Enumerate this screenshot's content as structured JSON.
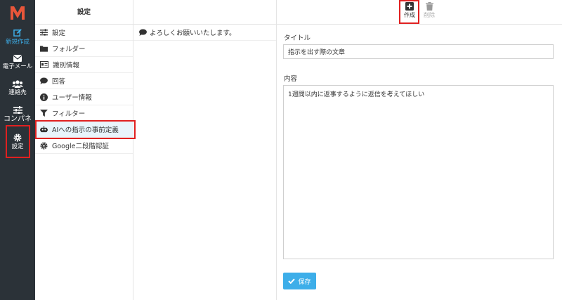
{
  "nav": {
    "items": [
      {
        "label": "新規作成",
        "icon": "edit-icon"
      },
      {
        "label": "電子メール",
        "icon": "envelope-icon"
      },
      {
        "label": "連絡先",
        "icon": "users-icon"
      },
      {
        "label": "コンパネ",
        "icon": "sliders-icon"
      },
      {
        "label": "設定",
        "icon": "gear-icon"
      }
    ],
    "compose_color": "#3daee9",
    "background": "#2b3238"
  },
  "menu": {
    "header": "設定",
    "items": [
      {
        "label": "設定",
        "icon": "sliders-icon"
      },
      {
        "label": "フォルダー",
        "icon": "folder-icon"
      },
      {
        "label": "識別情報",
        "icon": "id-card-icon"
      },
      {
        "label": "回答",
        "icon": "comment-icon"
      },
      {
        "label": "ユーザー情報",
        "icon": "info-icon"
      },
      {
        "label": "フィルター",
        "icon": "filter-icon"
      },
      {
        "label": "AIへの指示の事前定義",
        "icon": "robot-icon"
      },
      {
        "label": "Google二段階認証",
        "icon": "gear-icon"
      }
    ],
    "active_index": 6
  },
  "list": {
    "items": [
      {
        "text": "よろしくお願いいたします。",
        "icon": "comment-icon"
      }
    ]
  },
  "toolbar": {
    "create_label": "作成",
    "delete_label": "削除"
  },
  "form": {
    "title_label": "タイトル",
    "title_value": "指示を出す際の文章",
    "body_label": "内容",
    "body_value": "1週間以内に返事するように返信を考えてほしい",
    "save_label": "保存"
  },
  "colors": {
    "accent": "#3daee9",
    "highlight_box": "#e02020",
    "active_row": "#e9f4fb"
  }
}
